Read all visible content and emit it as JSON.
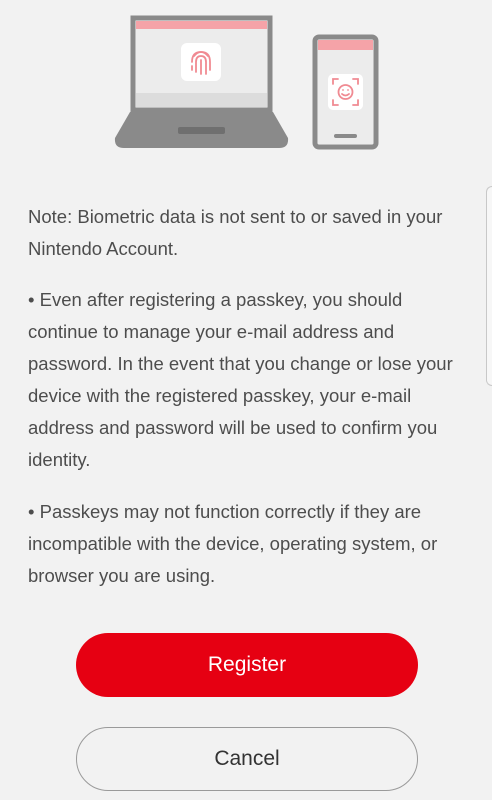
{
  "illustration": {
    "laptop_icon": "fingerprint-icon",
    "phone_icon": "face-scan-icon",
    "accent_color": "#f5a3a8",
    "device_color": "#8a8a8a"
  },
  "content": {
    "note": "Note: Biometric data is not sent to or saved in your Nintendo Account.",
    "bullet1": "• Even after registering a passkey, you should continue to manage your e-mail address and password. In the event that you change or lose your device with the registered passkey, your e-mail address and password will be used to confirm you identity.",
    "bullet2": "• Passkeys may not function correctly if they are incompatible with the device, operating system, or browser you are using."
  },
  "actions": {
    "register_label": "Register",
    "cancel_label": "Cancel",
    "brand_color": "#e60012"
  }
}
